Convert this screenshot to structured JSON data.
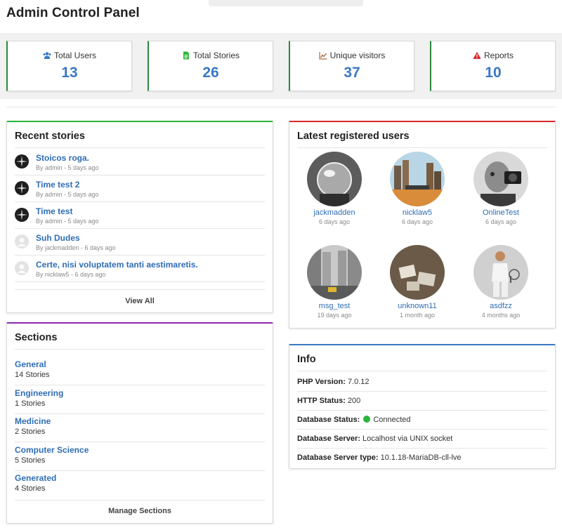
{
  "header": {
    "title": "Admin Control Panel"
  },
  "stats": [
    {
      "label": "Total Users",
      "value": "13",
      "icon": "users-icon",
      "icon_color": "#3a78c3"
    },
    {
      "label": "Total Stories",
      "value": "26",
      "icon": "file-icon",
      "icon_color": "#2bb53a"
    },
    {
      "label": "Unique visitors",
      "value": "37",
      "icon": "line-chart-icon",
      "icon_color": "#b06b3a"
    },
    {
      "label": "Reports",
      "value": "10",
      "icon": "warning-icon",
      "icon_color": "#d9262b"
    }
  ],
  "recent_stories": {
    "title": "Recent stories",
    "items": [
      {
        "title": "Stoicos roga.",
        "meta": "By admin - 5 days ago"
      },
      {
        "title": "Time test 2",
        "meta": "By admin - 5 days ago"
      },
      {
        "title": "Time test",
        "meta": "By admin - 5 days ago"
      },
      {
        "title": "Suh Dudes",
        "meta": "By jackmadden - 6 days ago"
      },
      {
        "title": "Certe, nisi voluptatem tanti aestimaretis.",
        "meta": "By nicklaw5 - 6 days ago"
      }
    ],
    "view_all": "View All",
    "accent": "#2bb53a"
  },
  "latest_users": {
    "title": "Latest registered users",
    "items": [
      {
        "name": "jackmadden",
        "time": "6 days ago"
      },
      {
        "name": "nicklaw5",
        "time": "6 days ago"
      },
      {
        "name": "OnlineTest",
        "time": "6 days ago"
      },
      {
        "name": "msg_test",
        "time": "19 days ago"
      },
      {
        "name": "unknown11",
        "time": "1 month ago"
      },
      {
        "name": "asdfzz",
        "time": "4 months ago"
      }
    ],
    "accent": "#d9262b"
  },
  "sections": {
    "title": "Sections",
    "items": [
      {
        "name": "General",
        "count": "14 Stories"
      },
      {
        "name": "Engineering",
        "count": "1 Stories"
      },
      {
        "name": "Medicine",
        "count": "2 Stories"
      },
      {
        "name": "Computer Science",
        "count": "5 Stories"
      },
      {
        "name": "Generated",
        "count": "4 Stories"
      }
    ],
    "manage": "Manage Sections",
    "accent": "#8e2aa8"
  },
  "info": {
    "title": "Info",
    "php_label": "PHP Version:",
    "php_value": "7.0.12",
    "http_label": "HTTP Status:",
    "http_value": "200",
    "db_status_label": "Database Status:",
    "db_status_value": "Connected",
    "db_server_label": "Database Server:",
    "db_server_value": "Localhost via UNIX socket",
    "db_type_label": "Database Server type:",
    "db_type_value": "10.1.18-MariaDB-cll-lve",
    "status_color": "#2bb53a",
    "accent": "#3a78c3"
  }
}
